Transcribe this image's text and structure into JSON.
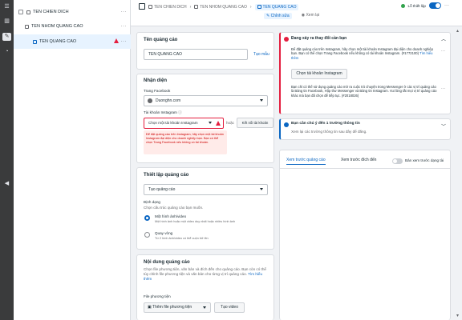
{
  "rail": {
    "icons": [
      "menu-icon",
      "chart-icon",
      "pencil-icon",
      "clock-icon",
      "collapse-icon"
    ]
  },
  "tree": {
    "campaign": {
      "label": "TEN CHIEN DICH",
      "more": "···"
    },
    "adset": {
      "label": "TEN NHOM QUANG CAO",
      "more": "···"
    },
    "ad": {
      "label": "TEN QUANG CAO",
      "more": "···"
    }
  },
  "topbar": {
    "crumbs": [
      "TEN CHIEN DICH",
      "TEN NHOM QUANG CAO",
      "TEN QUANG CAO"
    ],
    "tab_edit": "Chỉnh sửa",
    "tab_review": "Xem lại",
    "status": "Lỗ thiết lập"
  },
  "ad_name": {
    "heading": "Tên quảng cáo",
    "value": "TEN QUANG CAO",
    "template": "Tạo mẫu"
  },
  "identity": {
    "heading": "Nhận diện",
    "fb_label": "Trang Facebook",
    "page_name": "Duonghn.com",
    "ig_label": "Tài khoản Instagram",
    "ig_select": "Chọn một tài khoản Instagram",
    "or": "hoặc",
    "connect_btn": "Kết nối tài khoản",
    "error": "Để đặt quảng cáo trên Instagram, hãy chọn một tài khoản Instagram đại diện cho doanh nghiệp bạn. Bạn có thể chọn Trang Facebook nếu không có tài khoản."
  },
  "setup": {
    "heading": "Thiết lập quảng cáo",
    "create": "Tạo quảng cáo",
    "format_label": "Định dạng",
    "format_desc": "Chọn cấu trúc quảng cáo bạn muốn.",
    "opt1": "Một hình ảnh/video",
    "opt1_desc": "Một hình ảnh hoặc một video duy nhất hoặc nhiều hình ảnh",
    "opt2": "Quay vòng",
    "opt2_desc": "Từ 2 hình ảnh/video có thể cuộn trở lên"
  },
  "content": {
    "heading": "Nội dung quảng cáo",
    "desc": "Chọn file phương tiện, văn bản và đích đến cho quảng cáo. Bạn còn có thể tùy chỉnh file phương tiện và văn bản cho từng vị trí quảng cáo.",
    "more": "Tìm hiểu thêm",
    "media_label": "File phương tiện",
    "add_media": "Thêm file phương tiện",
    "create_video": "Tạo video"
  },
  "right": {
    "alert_title": "Đang xảy ra thay đổi cần bạn",
    "alert_p1": "Để đặt quảng cáo trên Instagram, hãy chọn một tài khoản Instagram đại diện cho doanh nghiệp bạn. Bạn có thể chọn Trang Facebook nếu không có tài khoản Instagram. (#1772100)",
    "alert_more": "Tìm hiểu thêm",
    "alert_btn": "Chọn tài khoản Instagram",
    "alert_p2": "Bạn chỉ có thể sử dụng quảng cáo mở ra cuộc trò chuyện trong Messenger ở các vị trí quảng cáo là Bảng tin Facebook, Hộp thư Messenger và Bảng tin Instagram. Vui lòng tắt mọi vị trí quảng cáo khác mà bạn đã chọn để tiếp tục. (#2018026)",
    "info_title": "Bạn cần chú ý đến 1 trường thông tin",
    "info_desc": "Xem lại các trường thông tin sau đây để đăng.",
    "preview_tab1": "Xem trước quảng cáo",
    "preview_tab2": "Xem trước đích đến",
    "preview_toggle": "Bản xem trước dạng tài"
  },
  "colors": {
    "accent": "#0a66c2",
    "error": "#e41e3f",
    "ok": "#31a24c"
  }
}
